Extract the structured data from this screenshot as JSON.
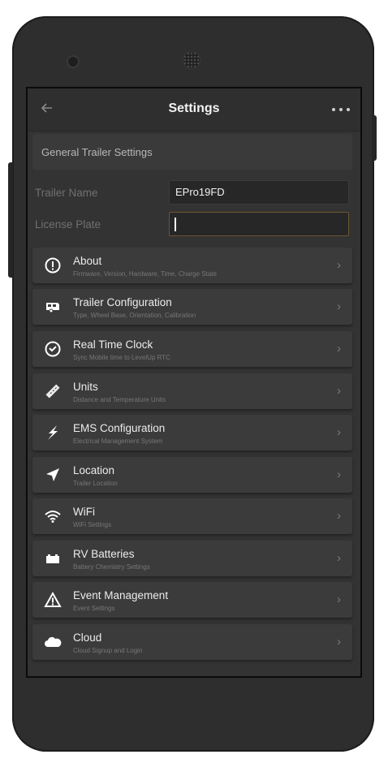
{
  "header": {
    "title": "Settings"
  },
  "general": {
    "title": "General Trailer Settings"
  },
  "fields": {
    "trailer_name": {
      "label": "Trailer Name",
      "value": "EPro19FD"
    },
    "license_plate": {
      "label": "License Plate",
      "value": ""
    }
  },
  "menu": [
    {
      "label": "About",
      "sub": "Firmware, Version, Hardware, Time, Charge State",
      "icon": "info-icon"
    },
    {
      "label": "Trailer Configuration",
      "sub": "Type, Wheel Base, Orientation, Calibration",
      "icon": "trailer-icon"
    },
    {
      "label": "Real Time Clock",
      "sub": "Sync Mobile time to LevelUp RTC",
      "icon": "clock-icon"
    },
    {
      "label": "Units",
      "sub": "Distance and Temperature Units",
      "icon": "ruler-icon"
    },
    {
      "label": "EMS Configuration",
      "sub": "Electrical Management System",
      "icon": "lightning-icon"
    },
    {
      "label": "Location",
      "sub": "Trailer Location",
      "icon": "location-arrow-icon"
    },
    {
      "label": "WiFi",
      "sub": "WiFi Settings",
      "icon": "wifi-icon"
    },
    {
      "label": "RV Batteries",
      "sub": "Battery Chemistry Settings",
      "icon": "battery-icon"
    },
    {
      "label": "Event Management",
      "sub": "Event Settings",
      "icon": "warning-icon"
    },
    {
      "label": "Cloud",
      "sub": "Cloud Signup and Login",
      "icon": "cloud-icon"
    }
  ],
  "colors": {
    "screen_bg": "#333333",
    "card_bg": "#3b3b3b",
    "focus_border": "#6b5631"
  }
}
